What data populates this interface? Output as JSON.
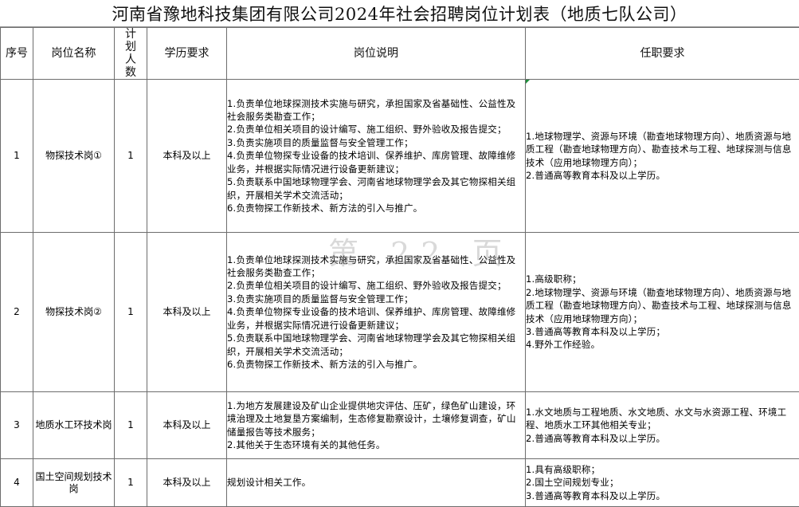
{
  "title": "河南省豫地科技集团有限公司2024年社会招聘岗位计划表（地质七队公司）",
  "headers": {
    "seq": "序号",
    "position": "岗位名称",
    "plan": "计划人数",
    "education": "学历要求",
    "description": "岗位说明",
    "requirements": "任职要求"
  },
  "rows": [
    {
      "seq": "1",
      "position": "物探技术岗①",
      "plan": "1",
      "education": "本科及以上",
      "description": [
        "1.负责单位地球探测技术实施与研究，承担国家及省基础性、公益性及社会服务类勘查工作；",
        "2.负责单位相关项目的设计编写、施工组织、野外验收及报告提交；",
        "3.负责实施项目的质量监督与安全管理工作；",
        "4.负责单位物探专业设备的技术培训、保养维护、库房管理、故障维修业务，并根据实际情况进行设备更新建议；",
        "5.负责联系中国地球物理学会、河南省地球物理学会及其它物探相关组织，开展相关学术交流活动；",
        "6.负责物探工作新技术、新方法的引入与推广。"
      ],
      "requirements": [
        "1.地球物理学、资源与环境（勘查地球物理方向）、地质资源与地质工程（勘查地球物理方向）、勘查技术与工程、地球探测与信息技术（应用地球物理方向）；",
        "2.普通高等教育本科及以上学历。"
      ]
    },
    {
      "seq": "2",
      "position": "物探技术岗②",
      "plan": "1",
      "education": "本科及以上",
      "description": [
        "1.负责单位地球探测技术实施与研究，承担国家及省基础性、公益性及社会服务类勘查工作；",
        "2.负责单位相关项目的设计编写、施工组织、野外验收及报告提交；",
        "3.负责实施项目的质量监督与安全管理工作；",
        "4.负责单位物探专业设备的技术培训、保养维护、库房管理、故障维修业务，并根据实际情况进行设备更新建议；",
        "5.负责联系中国地球物理学会、河南省地球物理学会及其它物探相关组织，开展相关学术交流活动；",
        "6.负责物探工作新技术、新方法的引入与推广。"
      ],
      "requirements": [
        "1.高级职称；",
        "2.地球物理学、资源与环境（勘查地球物理方向）、地质资源与地质工程（勘查地球物理方向）、勘查技术与工程、地球探测与信息技术（应用地球物理方向）；",
        "3.普通高等教育本科及以上学历；",
        "4.野外工作经验。"
      ]
    },
    {
      "seq": "3",
      "position": "地质水工环技术岗",
      "plan": "1",
      "education": "本科及以上",
      "description": [
        "1.为地方发展建设及矿山企业提供地灾评估、压矿，绿色矿山建设，环境治理及土地复垦方案编制，生态修复勘察设计，土壤修复调查，矿山储量报告等技术服务；",
        "2.其他关于生态环境有关的其他任务。"
      ],
      "requirements": [
        "1.水文地质与工程地质、水文地质、水文与水资源工程、环境工程、地质水工环其他相关专业；",
        "2.普通高等教育本科及以上学历。"
      ]
    },
    {
      "seq": "4",
      "position": "国土空间规划技术岗",
      "plan": "1",
      "education": "本科及以上",
      "description": [
        "规划设计相关工作。"
      ],
      "requirements": [
        "1.具有高级职称；",
        "2.国土空间规划专业；",
        "3.普通高等教育本科及以上学历。"
      ]
    }
  ],
  "watermark": "第 22 页"
}
